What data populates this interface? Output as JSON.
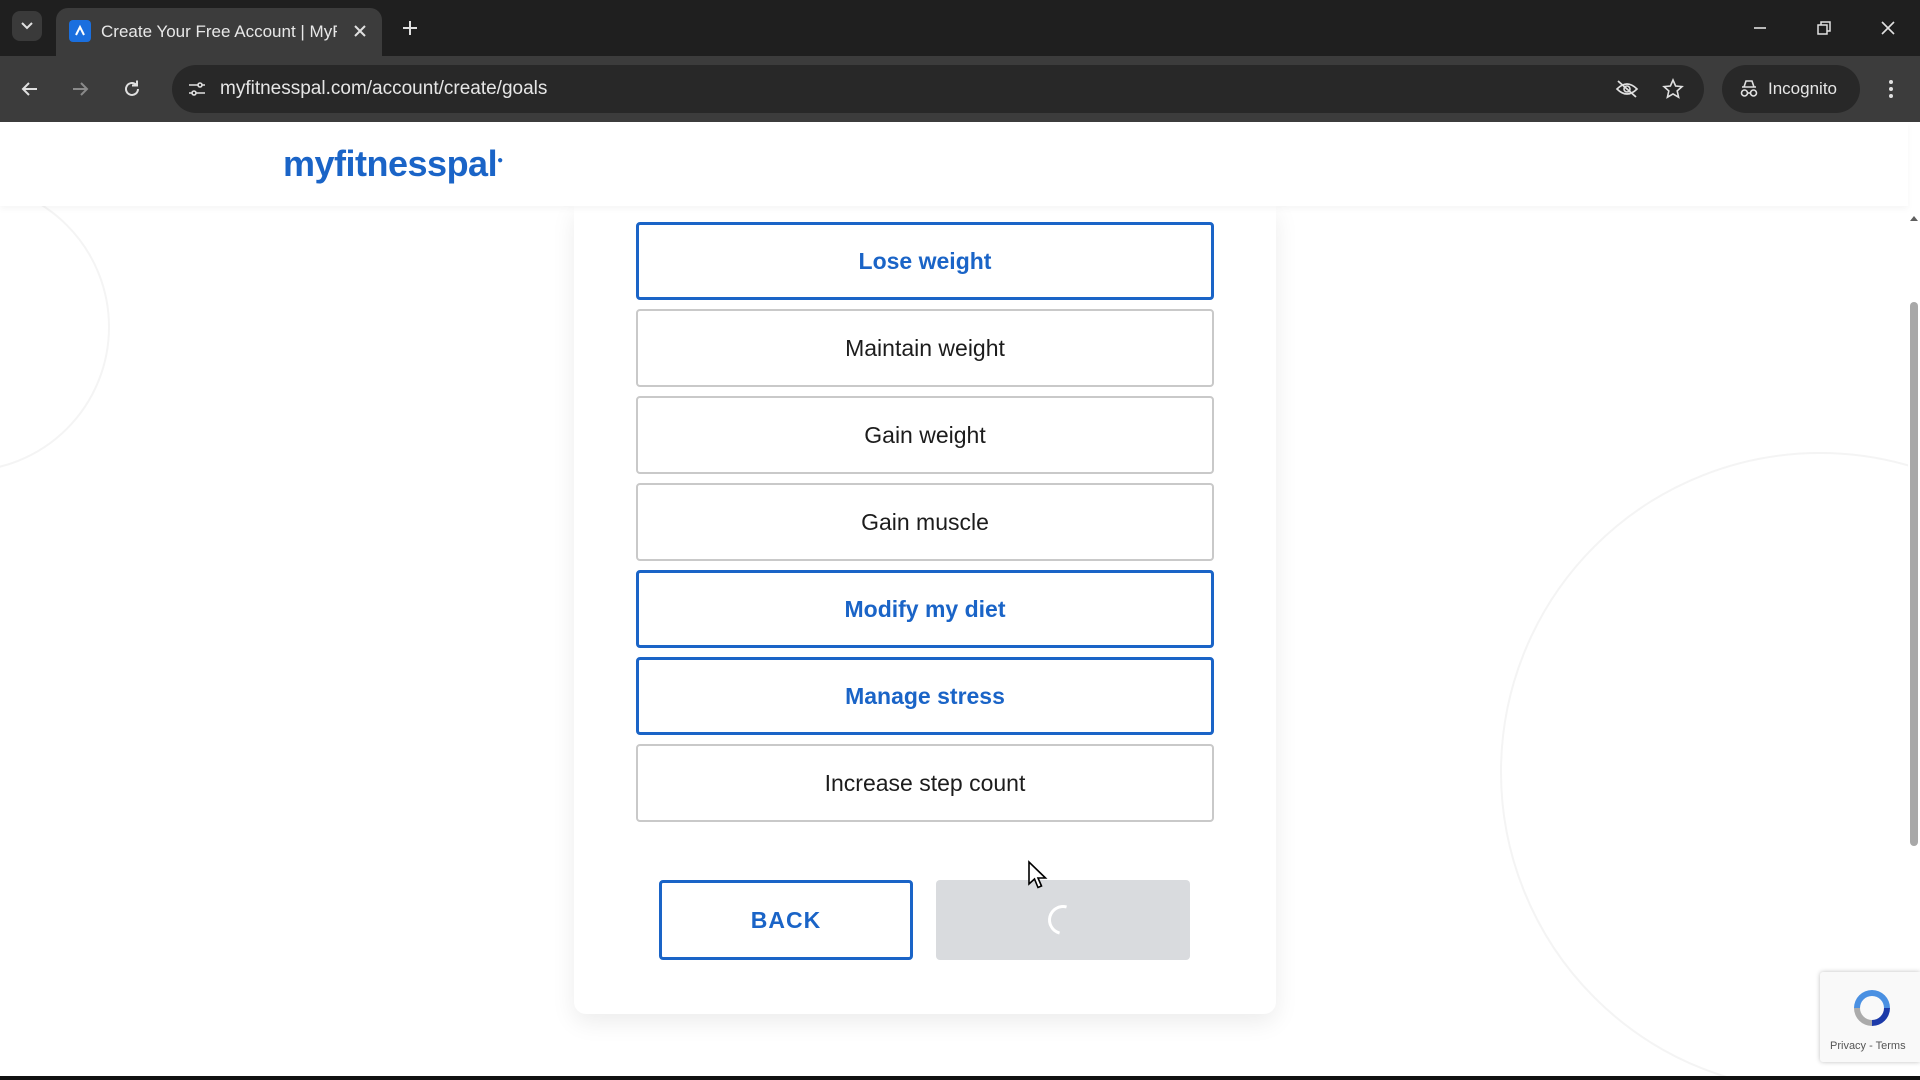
{
  "browser": {
    "tab_title": "Create Your Free Account | MyF",
    "url": "myfitnesspal.com/account/create/goals",
    "incognito_label": "Incognito"
  },
  "site": {
    "logo": "myfitnesspal"
  },
  "goals": [
    {
      "label": "Lose weight",
      "selected": true
    },
    {
      "label": "Maintain weight",
      "selected": false
    },
    {
      "label": "Gain weight",
      "selected": false
    },
    {
      "label": "Gain muscle",
      "selected": false
    },
    {
      "label": "Modify my diet",
      "selected": true
    },
    {
      "label": "Manage stress",
      "selected": true
    },
    {
      "label": "Increase step count",
      "selected": false
    }
  ],
  "actions": {
    "back_label": "BACK",
    "next_state": "loading"
  },
  "recaptcha": {
    "privacy": "Privacy",
    "separator": " - ",
    "terms": "Terms"
  },
  "colors": {
    "brand": "#1a64c7",
    "option_border": "#c9c9c9",
    "disabled_button": "#d9dbde"
  }
}
